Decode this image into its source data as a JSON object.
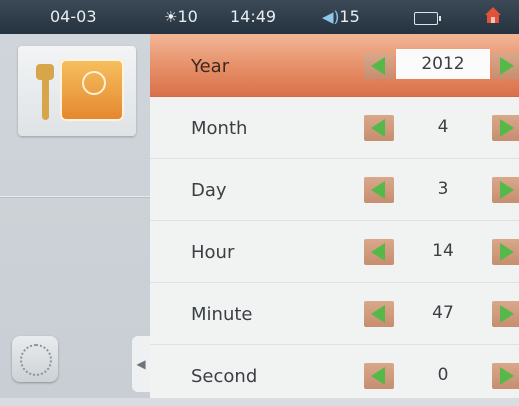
{
  "status_bar": {
    "date": "04-03",
    "weather_icon": "sun-icon",
    "temperature": "10",
    "time": "14:49",
    "volume_icon": "speaker-icon",
    "volume": "15",
    "battery_icon": "battery-icon",
    "home_icon": "home-icon"
  },
  "sidebar": {
    "tool_icon": "settings-tools-icon",
    "globe_icon": "globe-icon",
    "collapse_icon": "chevron-left-icon"
  },
  "rows": [
    {
      "label": "Year",
      "value": "2012",
      "selected": true
    },
    {
      "label": "Month",
      "value": "4"
    },
    {
      "label": "Day",
      "value": "3"
    },
    {
      "label": "Hour",
      "value": "14"
    },
    {
      "label": "Minute",
      "value": "47"
    },
    {
      "label": "Second",
      "value": "0"
    }
  ],
  "colors": {
    "accent_selected": "#e48a63",
    "arrow_green": "#55b94a"
  }
}
